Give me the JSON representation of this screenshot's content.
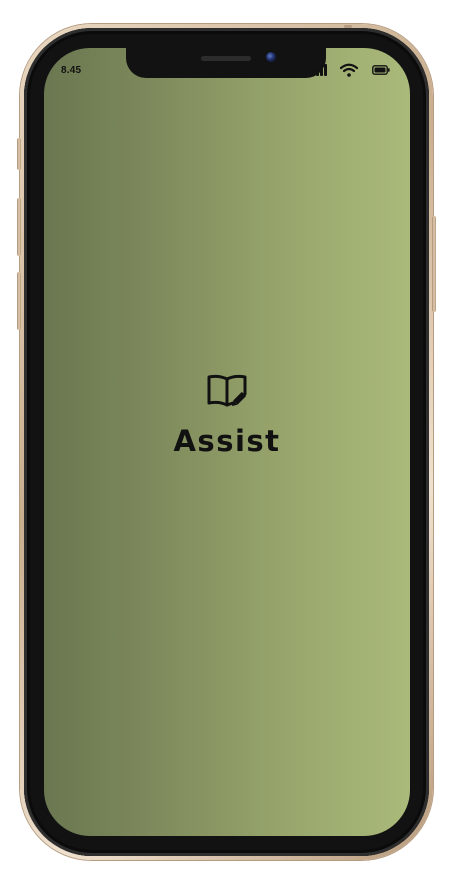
{
  "status_bar": {
    "time": "8.45",
    "icons": [
      "signal-icon",
      "wifi-icon",
      "battery-icon"
    ]
  },
  "splash": {
    "icon": "book-edit-icon",
    "title": "Assist"
  },
  "theme": {
    "screen_gradient_start": "#6a7750",
    "screen_gradient_end": "#aaba7a",
    "frame_color": "#c9ae8f",
    "text_color": "#111111"
  }
}
